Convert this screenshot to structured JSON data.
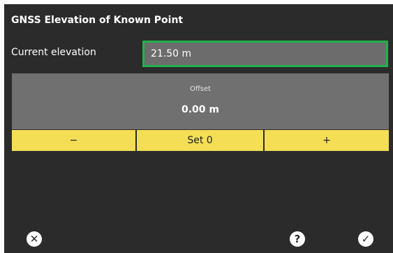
{
  "dialog": {
    "title": "GNSS Elevation of Known Point",
    "current_elevation_label": "Current elevation",
    "current_elevation_value": "21.50 m",
    "offset_label": "Offset",
    "offset_value": "0.00 m"
  },
  "buttons": {
    "minus": "−",
    "set0": "Set 0",
    "plus": "+"
  },
  "footer": {
    "cancel_icon": "✕",
    "help_icon": "?",
    "confirm_icon": "✓"
  },
  "colors": {
    "dialog_bg": "#2b2b2b",
    "field_bg": "#6c6c6c",
    "field_border_focus": "#22b14c",
    "panel_bg": "#707070",
    "button_yellow": "#f3de55"
  }
}
